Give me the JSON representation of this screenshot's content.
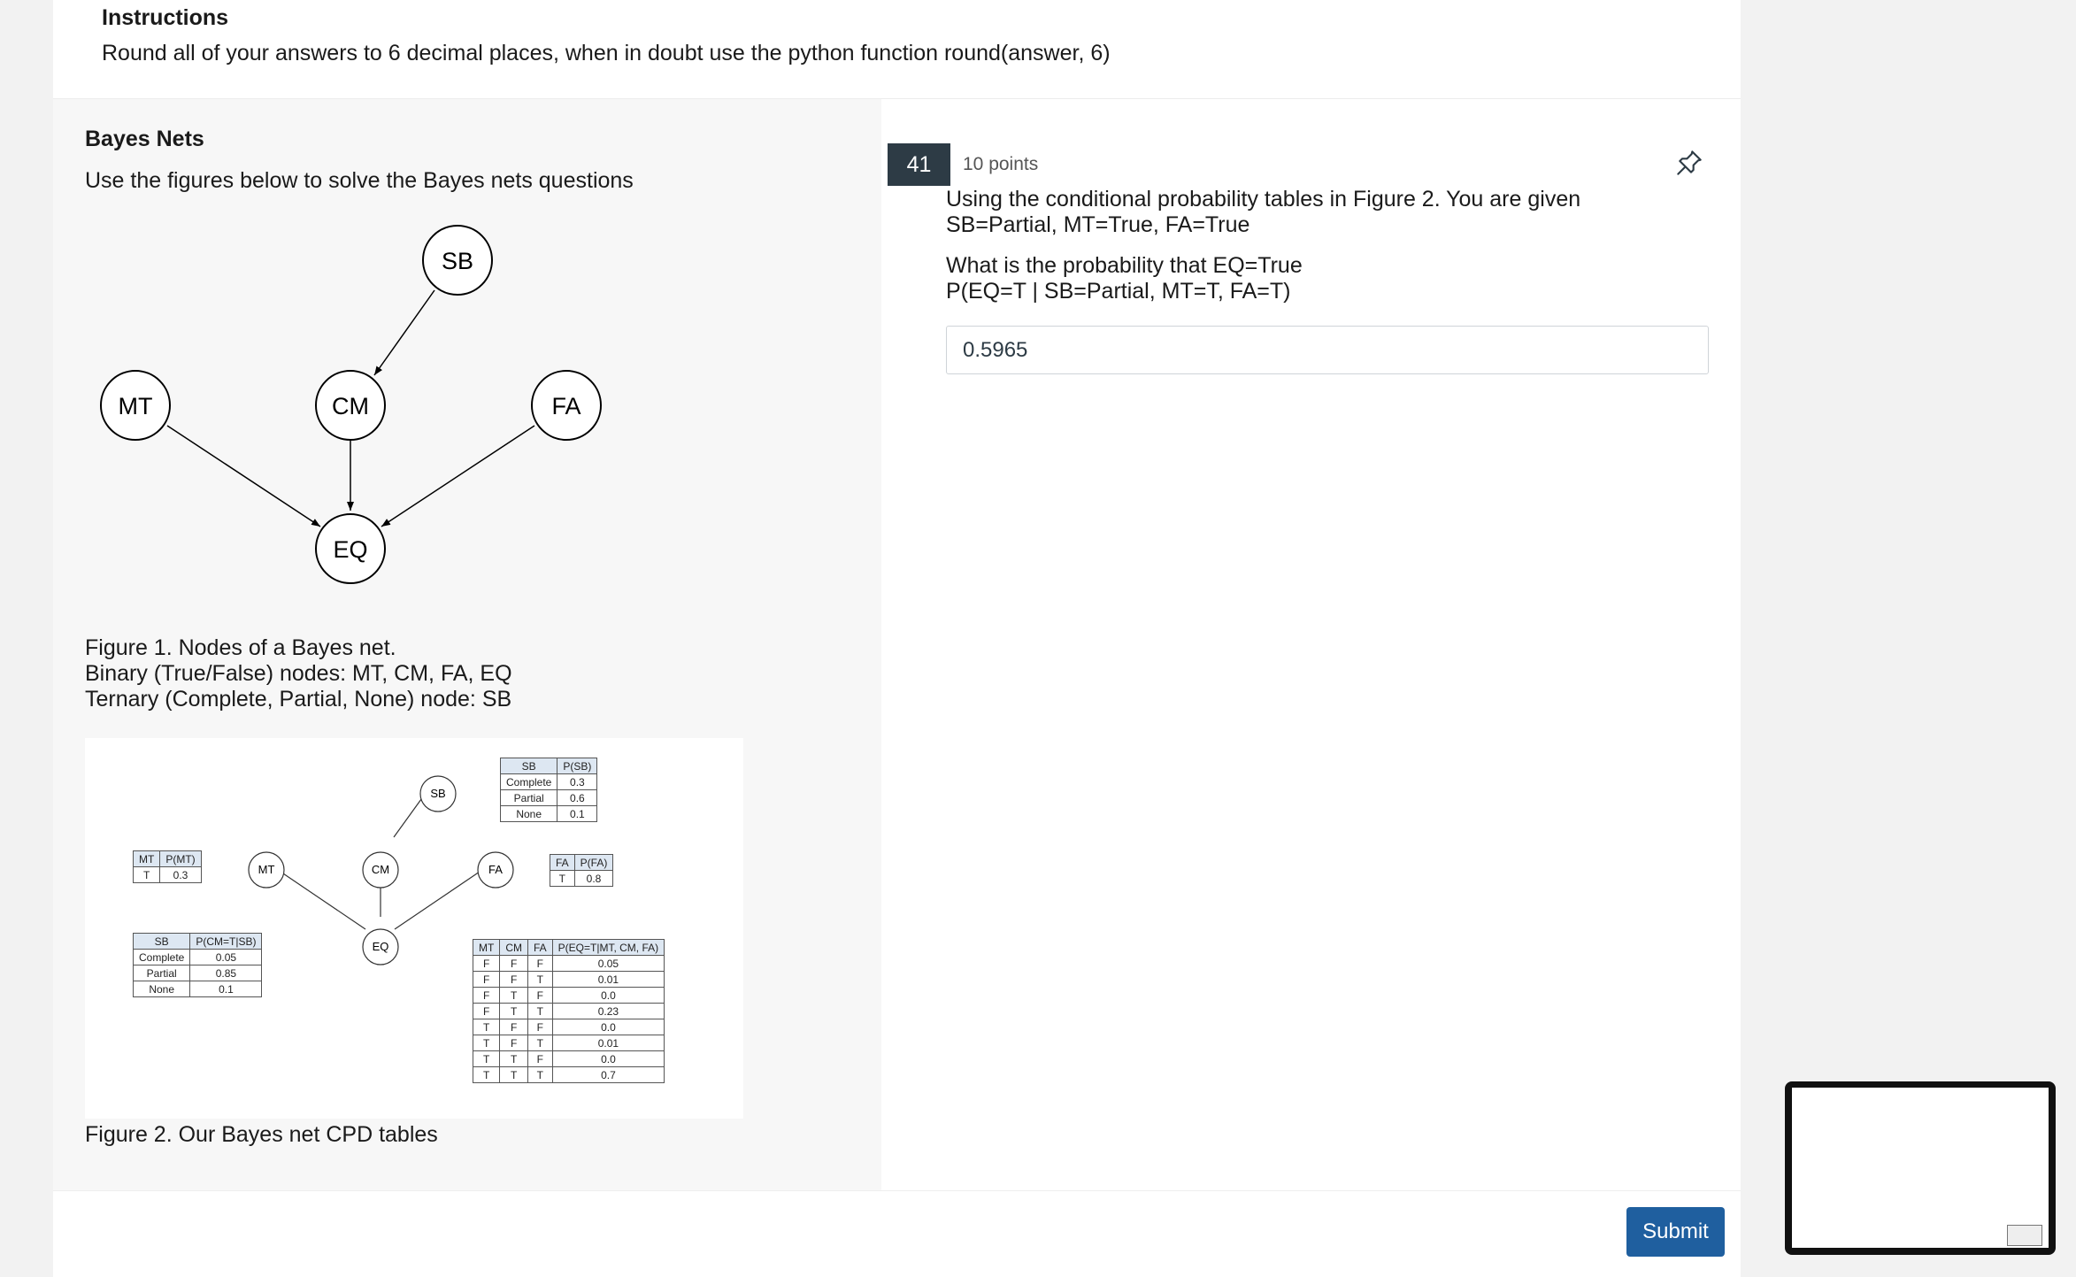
{
  "instructions": {
    "title": "Instructions",
    "text": "Round all of your answers to 6 decimal places, when in doubt use the python function round(answer, 6)"
  },
  "bayes": {
    "title": "Bayes Nets",
    "subtitle": "Use the figures below to solve the Bayes nets questions",
    "nodes": {
      "sb": "SB",
      "mt": "MT",
      "cm": "CM",
      "fa": "FA",
      "eq": "EQ"
    },
    "figure1_caption": [
      "Figure 1. Nodes of a Bayes net.",
      "Binary (True/False) nodes: MT, CM, FA, EQ",
      "Ternary (Complete, Partial, None) node: SB"
    ],
    "figure2_caption": "Figure 2. Our Bayes net CPD tables",
    "cpd": {
      "mt": {
        "headers": [
          "MT",
          "P(MT)"
        ],
        "rows": [
          [
            "T",
            "0.3"
          ]
        ]
      },
      "fa": {
        "headers": [
          "FA",
          "P(FA)"
        ],
        "rows": [
          [
            "T",
            "0.8"
          ]
        ]
      },
      "sb": {
        "headers": [
          "SB",
          "P(SB)"
        ],
        "rows": [
          [
            "Complete",
            "0.3"
          ],
          [
            "Partial",
            "0.6"
          ],
          [
            "None",
            "0.1"
          ]
        ]
      },
      "cm": {
        "headers": [
          "SB",
          "P(CM=T|SB)"
        ],
        "rows": [
          [
            "Complete",
            "0.05"
          ],
          [
            "Partial",
            "0.85"
          ],
          [
            "None",
            "0.1"
          ]
        ]
      },
      "eq": {
        "headers": [
          "MT",
          "CM",
          "FA",
          "P(EQ=T|MT, CM, FA)"
        ],
        "rows": [
          [
            "F",
            "F",
            "F",
            "0.05"
          ],
          [
            "F",
            "F",
            "T",
            "0.01"
          ],
          [
            "F",
            "T",
            "F",
            "0.0"
          ],
          [
            "F",
            "T",
            "T",
            "0.23"
          ],
          [
            "T",
            "F",
            "F",
            "0.0"
          ],
          [
            "T",
            "F",
            "T",
            "0.01"
          ],
          [
            "T",
            "T",
            "F",
            "0.0"
          ],
          [
            "T",
            "T",
            "T",
            "0.7"
          ]
        ]
      }
    }
  },
  "question": {
    "number": "41",
    "points": "10 points",
    "lines": [
      "Using the conditional probability tables in Figure 2. You are given",
      "SB=Partial, MT=True, FA=True",
      "What is the probability that EQ=True",
      "P(EQ=T | SB=Partial, MT=T, FA=T)"
    ],
    "answer_value": "0.5965"
  },
  "footer": {
    "submit_label": "Submit"
  },
  "icons": {
    "pin": "pin-icon"
  },
  "colors": {
    "question_badge": "#2d3b45",
    "submit": "#1f5f9f",
    "table_header": "#dde7f2"
  }
}
